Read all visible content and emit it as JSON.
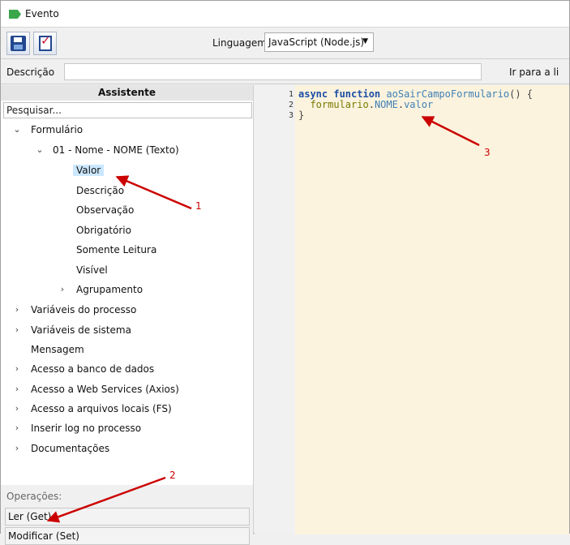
{
  "window": {
    "title": "Evento"
  },
  "toolbar": {
    "save_icon": "save-disk-icon",
    "validate_icon": "check-document-icon",
    "language_label": "Linguagem",
    "language_value": "JavaScript (Node.js)"
  },
  "description": {
    "label": "Descrição",
    "value": "",
    "goto_label": "Ir para a li"
  },
  "assistant": {
    "header": "Assistente",
    "search_placeholder": "Pesquisar...",
    "tree": [
      {
        "label": "Formulário",
        "expanded": true
      },
      {
        "label": "01 - Nome - NOME (Texto)",
        "expanded": true
      },
      {
        "label": "Valor",
        "selected": true
      },
      {
        "label": "Descrição"
      },
      {
        "label": "Observação"
      },
      {
        "label": "Obrigatório"
      },
      {
        "label": "Somente Leitura"
      },
      {
        "label": "Visível"
      },
      {
        "label": "Agrupamento",
        "expanded": false
      },
      {
        "label": "Variáveis do processo",
        "expanded": false
      },
      {
        "label": "Variáveis de sistema",
        "expanded": false
      },
      {
        "label": "Mensagem"
      },
      {
        "label": "Acesso a banco de dados",
        "expanded": false
      },
      {
        "label": "Acesso a Web Services (Axios)",
        "expanded": false
      },
      {
        "label": "Acesso a arquivos locais (FS)",
        "expanded": false
      },
      {
        "label": "Inserir log no processo",
        "expanded": false
      },
      {
        "label": "Documentações",
        "expanded": false
      }
    ],
    "operations_label": "Operações:",
    "operations": [
      "Ler (Get)",
      "Modificar (Set)"
    ]
  },
  "editor": {
    "line_numbers": [
      "1",
      "2",
      "3"
    ],
    "line1": {
      "kw1": "async",
      "kw2": "function",
      "fn": "aoSairCampoFormulario",
      "tail": "() {"
    },
    "line2": {
      "obj": "formulario",
      "dot1": ".",
      "prop1": "NOME",
      "dot2": ".",
      "prop2": "valor"
    },
    "line3": "}"
  },
  "annotations": [
    "1",
    "2",
    "3"
  ],
  "colors": {
    "annotation": "#cc0000",
    "selection": "#cce8ff",
    "editor_bg": "#fbf3de"
  }
}
